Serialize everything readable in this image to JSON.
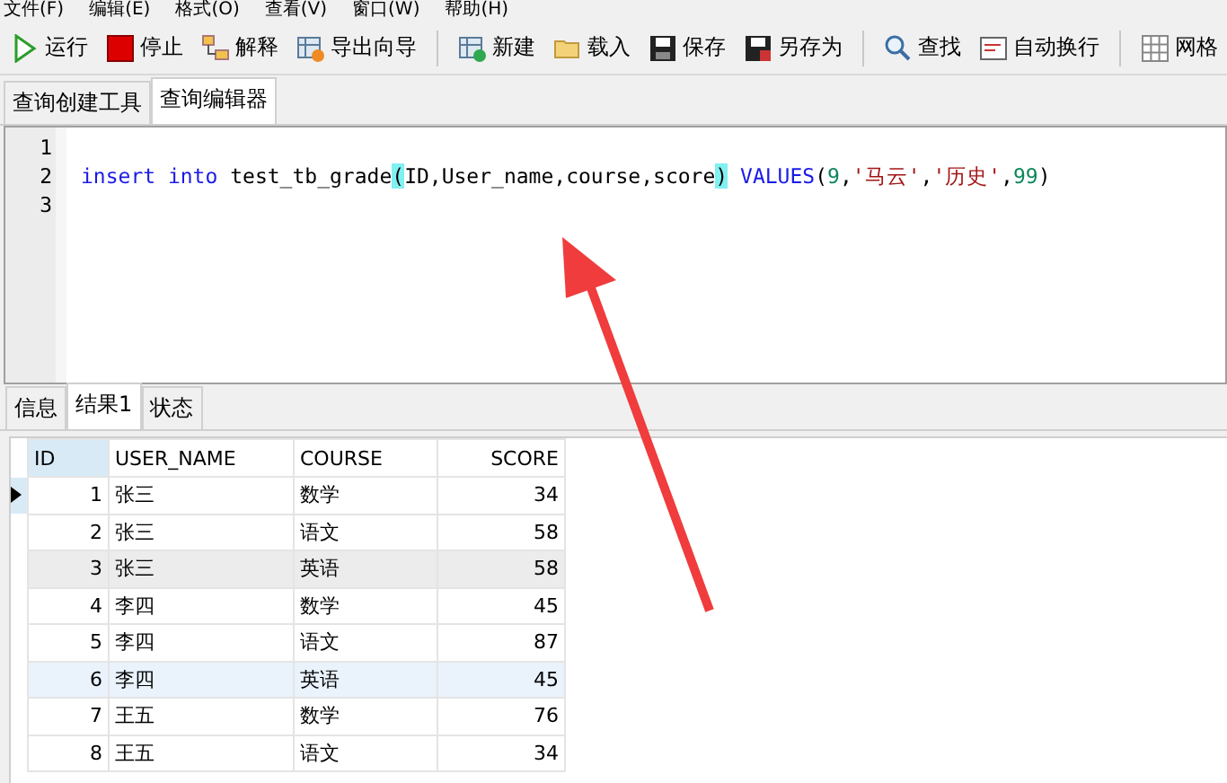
{
  "menu_bar": [
    "文件(F)",
    "编辑(E)",
    "格式(O)",
    "查看(V)",
    "窗口(W)",
    "帮助(H)"
  ],
  "toolbar": [
    {
      "kind": "button",
      "label": "运行"
    },
    {
      "kind": "button",
      "label": "停止"
    },
    {
      "kind": "button",
      "label": "解释"
    },
    {
      "kind": "button",
      "label": "导出向导"
    },
    {
      "kind": "separator"
    },
    {
      "kind": "button",
      "label": "新建"
    },
    {
      "kind": "button",
      "label": "载入"
    },
    {
      "kind": "button",
      "label": "保存"
    },
    {
      "kind": "button",
      "label": "另存为"
    },
    {
      "kind": "separator"
    },
    {
      "kind": "button",
      "label": "查找"
    },
    {
      "kind": "button",
      "label": "自动换行"
    },
    {
      "kind": "separator"
    },
    {
      "kind": "button",
      "label": "网格"
    }
  ],
  "editor_tabs": [
    {
      "label": "查询创建工具",
      "selected": false
    },
    {
      "label": "查询编辑器",
      "selected": true
    }
  ],
  "editor": {
    "lines": [
      {
        "number": "1"
      },
      {
        "number": "2",
        "tokens": [
          {
            "kind": "keyword",
            "text": "insert into"
          },
          {
            "kind": "plain",
            "text": "test_tb_grade"
          },
          {
            "kind": "paren",
            "text": "("
          },
          {
            "kind": "plain",
            "text": "ID,User_name,course,score"
          },
          {
            "kind": "paren",
            "text": ")"
          },
          {
            "kind": "keyword",
            "text": "VALUES"
          },
          {
            "kind": "plain",
            "text": "("
          },
          {
            "kind": "number",
            "text": "9"
          },
          {
            "kind": "plain",
            "text": ","
          },
          {
            "kind": "string",
            "text": "'马云'"
          },
          {
            "kind": "plain",
            "text": ","
          },
          {
            "kind": "string",
            "text": "'历史'"
          },
          {
            "kind": "plain",
            "text": ","
          },
          {
            "kind": "number",
            "text": "99"
          },
          {
            "kind": "plain",
            "text": ")"
          }
        ]
      },
      {
        "number": "3"
      }
    ]
  },
  "result_tabs": [
    {
      "label": "信息",
      "selected": false
    },
    {
      "label": "结果1",
      "selected": true
    },
    {
      "label": "状态",
      "selected": false
    }
  ],
  "table": {
    "columns": [
      "ID",
      "USER_NAME",
      "COURSE",
      "SCORE"
    ],
    "rows": [
      {
        "selected": true,
        "hovered": false,
        "focused": false,
        "cells": [
          "1",
          "张三",
          "数学",
          "34"
        ]
      },
      {
        "selected": false,
        "hovered": false,
        "focused": false,
        "cells": [
          "2",
          "张三",
          "语文",
          "58"
        ]
      },
      {
        "selected": false,
        "hovered": true,
        "focused": false,
        "cells": [
          "3",
          "张三",
          "英语",
          "58"
        ]
      },
      {
        "selected": false,
        "hovered": false,
        "focused": false,
        "cells": [
          "4",
          "李四",
          "数学",
          "45"
        ]
      },
      {
        "selected": false,
        "hovered": false,
        "focused": false,
        "cells": [
          "5",
          "李四",
          "语文",
          "87"
        ]
      },
      {
        "selected": false,
        "hovered": false,
        "focused": true,
        "cells": [
          "6",
          "李四",
          "英语",
          "45"
        ]
      },
      {
        "selected": false,
        "hovered": false,
        "focused": false,
        "cells": [
          "7",
          "王五",
          "数学",
          "76"
        ]
      },
      {
        "selected": false,
        "hovered": false,
        "focused": false,
        "cells": [
          "8",
          "王五",
          "语文",
          "34"
        ]
      }
    ]
  }
}
